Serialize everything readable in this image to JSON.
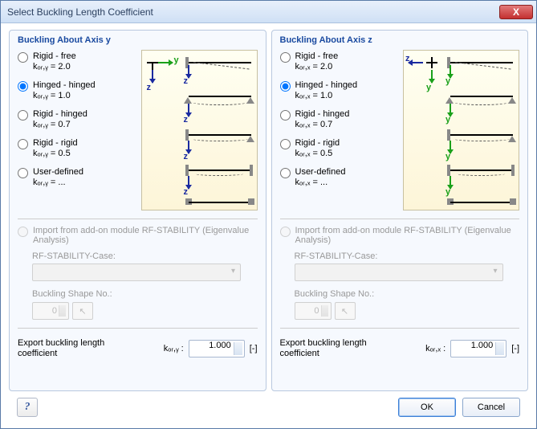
{
  "window": {
    "title": "Select Buckling Length Coefficient",
    "close": "X"
  },
  "panels": {
    "y": {
      "title": "Buckling About Axis y",
      "options": [
        {
          "label": "Rigid - free",
          "sub": "kₒᵣ,ᵧ = 2.0"
        },
        {
          "label": "Hinged - hinged",
          "sub": "kₒᵣ,ᵧ = 1.0"
        },
        {
          "label": "Rigid - hinged",
          "sub": "kₒᵣ,ᵧ = 0.7"
        },
        {
          "label": "Rigid - rigid",
          "sub": "kₒᵣ,ᵧ = 0.5"
        },
        {
          "label": "User-defined",
          "sub": "kₒᵣ,ᵧ = ..."
        }
      ],
      "selected": 1,
      "axis_main": "y",
      "axis_sec": "z",
      "import": {
        "label": "Import from add-on module RF-STABILITY (Eigenvalue Analysis)",
        "case_label": "RF-STABILITY-Case:",
        "shape_label": "Buckling Shape No.:",
        "shape_val": "0"
      },
      "export": {
        "label": "Export buckling length coefficient",
        "coef_label": "kₒᵣ,ᵧ :",
        "value": "1.000",
        "unit": "[-]"
      }
    },
    "z": {
      "title": "Buckling About Axis z",
      "options": [
        {
          "label": "Rigid - free",
          "sub": "kₒᵣ,ₓ = 2.0"
        },
        {
          "label": "Hinged - hinged",
          "sub": "kₒᵣ,ₓ = 1.0"
        },
        {
          "label": "Rigid - hinged",
          "sub": "kₒᵣ,ₓ = 0.7"
        },
        {
          "label": "Rigid - rigid",
          "sub": "kₒᵣ,ₓ = 0.5"
        },
        {
          "label": "User-defined",
          "sub": "kₒᵣ,ₓ = ..."
        }
      ],
      "selected": 1,
      "axis_main": "z",
      "axis_sec": "y",
      "import": {
        "label": "Import from add-on module RF-STABILITY (Eigenvalue Analysis)",
        "case_label": "RF-STABILITY-Case:",
        "shape_label": "Buckling Shape No.:",
        "shape_val": "0"
      },
      "export": {
        "label": "Export buckling length coefficient",
        "coef_label": "kₒᵣ,ₓ :",
        "value": "1.000",
        "unit": "[-]"
      }
    }
  },
  "footer": {
    "help": "?",
    "ok": "OK",
    "cancel": "Cancel"
  }
}
